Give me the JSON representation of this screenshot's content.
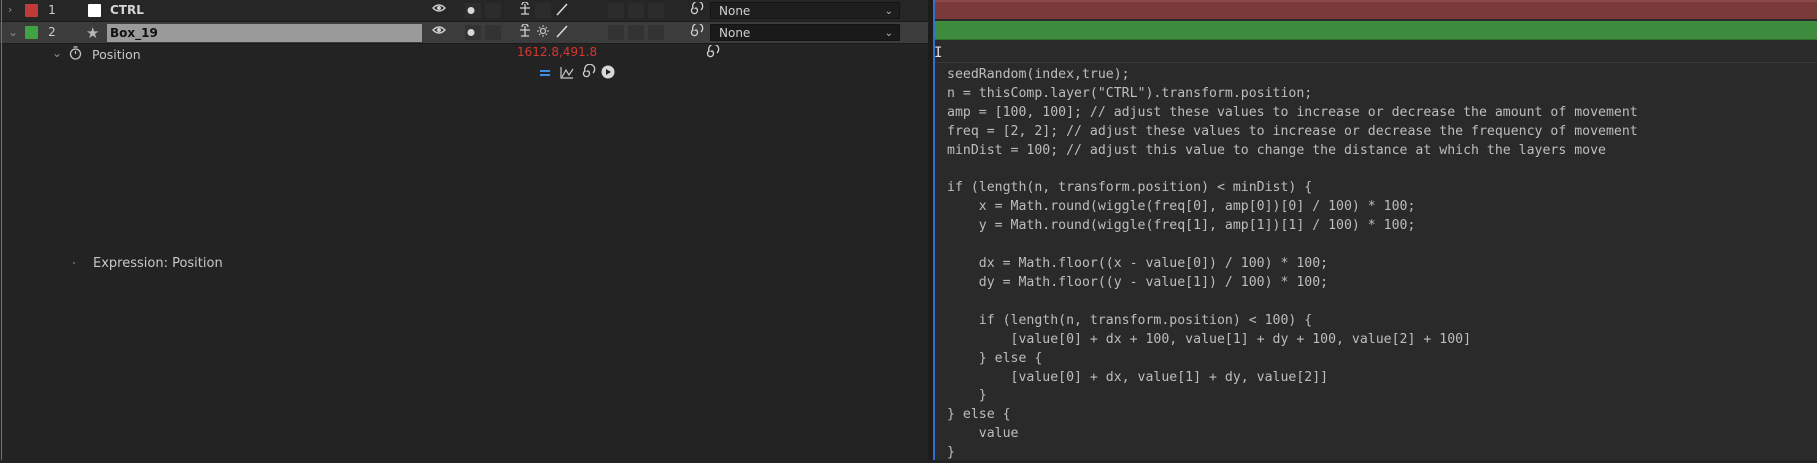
{
  "layers": [
    {
      "index": "1",
      "name": "CTRL",
      "label_color": "#c0393b",
      "parent": "None",
      "expanded": false
    },
    {
      "index": "2",
      "name": "Box_19",
      "label_color": "#3fa43f",
      "parent": "None",
      "expanded": true
    }
  ],
  "property": {
    "name": "Position",
    "value": "1612.8,491.8"
  },
  "expression_label": "Expression: Position",
  "code_lines": "seedRandom(index,true);\nn = thisComp.layer(\"CTRL\").transform.position;\namp = [100, 100]; // adjust these values to increase or decrease the amount of movement\nfreq = [2, 2]; // adjust these values to increase or decrease the frequency of movement\nminDist = 100; // adjust this value to change the distance at which the layers move\n\nif (length(n, transform.position) < minDist) {\n    x = Math.round(wiggle(freq[0], amp[0])[0] / 100) * 100;\n    y = Math.round(wiggle(freq[1], amp[1])[1] / 100) * 100;\n\n    dx = Math.floor((x - value[0]) / 100) * 100;\n    dy = Math.floor((y - value[1]) / 100) * 100;\n\n    if (length(n, transform.position) < 100) {\n        [value[0] + dx + 100, value[1] + dy + 100, value[2] + 100]\n    } else {\n        [value[0] + dx, value[1] + dy, value[2]]\n    }\n} else {\n    value\n}",
  "colors": {
    "timeline_layer1": "#7a3a3a",
    "timeline_layer2": "#3e8c3e",
    "accent_blue": "#2e6fd1",
    "value_red": "#d4372f"
  },
  "icons": {
    "twirl_collapsed": "chevron-right-icon",
    "twirl_expanded": "chevron-down-icon",
    "stopwatch": "stopwatch-icon",
    "visibility": "eye-icon",
    "solo": "solo-dot-icon",
    "shy": "shy-icon",
    "fx": "effect-icon",
    "pickwhip": "pickwhip-icon"
  }
}
